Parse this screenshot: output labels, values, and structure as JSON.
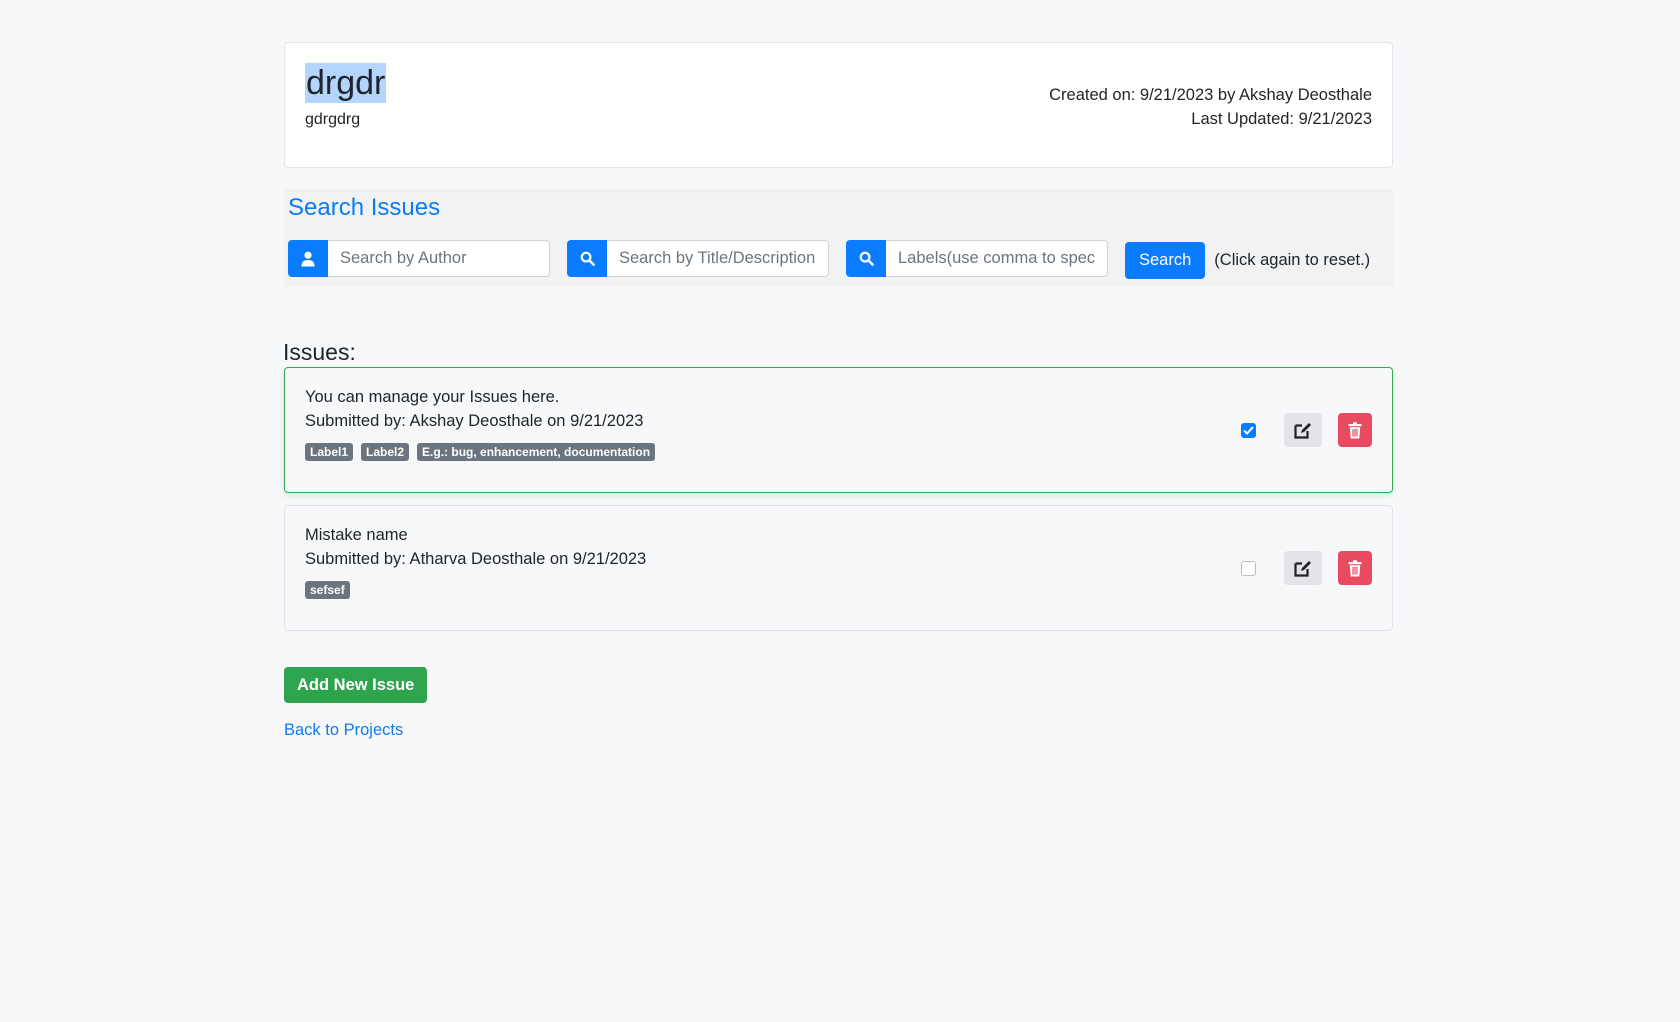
{
  "project": {
    "title": "drgdr",
    "description": "gdrgdrg",
    "created": "Created on: 9/21/2023 by Akshay Deosthale",
    "updated": "Last Updated: 9/21/2023"
  },
  "search": {
    "title": "Search Issues",
    "author_placeholder": "Search by Author",
    "title_placeholder": "Search by Title/Description",
    "labels_placeholder": "Labels(use comma to specify multiple)",
    "button_label": "Search",
    "hint": "(Click again to reset.)"
  },
  "issues": {
    "heading": "Issues:",
    "items": [
      {
        "title": "You can manage your Issues here.",
        "submitted": "Submitted by: Akshay Deosthale on 9/21/2023",
        "labels": [
          "Label1",
          "Label2",
          "E.g.: bug, enhancement, documentation"
        ],
        "checked": true
      },
      {
        "title": "Mistake name",
        "submitted": "Submitted by: Atharva Deosthale on 9/21/2023",
        "labels": [
          "sefsef"
        ],
        "checked": false
      }
    ]
  },
  "actions": {
    "add_issue": "Add New Issue",
    "back_link": "Back to Projects"
  },
  "colors": {
    "primary": "#0b7bff",
    "success": "#2ea44f",
    "danger": "#e84a5f",
    "badge": "#6c757d"
  }
}
